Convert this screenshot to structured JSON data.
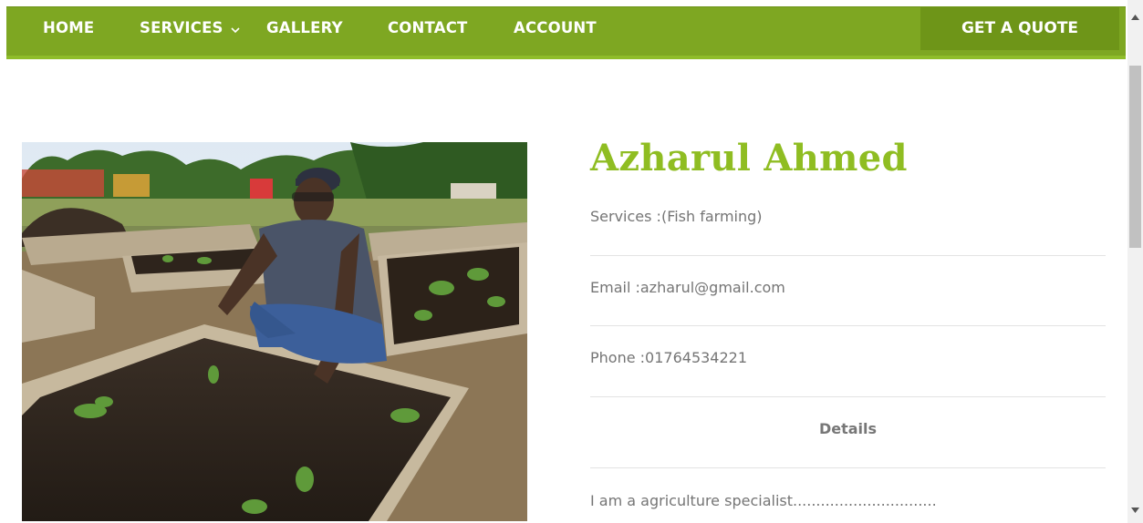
{
  "nav": {
    "home": "HOME",
    "services": "SERVICES",
    "gallery": "GALLERY",
    "contact": "CONTACT",
    "account": "ACCOUNT",
    "quote": "GET A QUOTE"
  },
  "profile": {
    "name": "Azharul Ahmed",
    "services": "Services :(Fish farming)",
    "email": "Email :azharul@gmail.com",
    "phone": "Phone :01764534221",
    "details_heading": "Details",
    "bio": "I am a  agriculture specialist..............................."
  },
  "colors": {
    "nav_bg": "#7ea722",
    "quote_bg": "#6e9518",
    "name_green": "#8fbd22"
  },
  "icons": {
    "services_dropdown": "chevron-down-icon"
  }
}
